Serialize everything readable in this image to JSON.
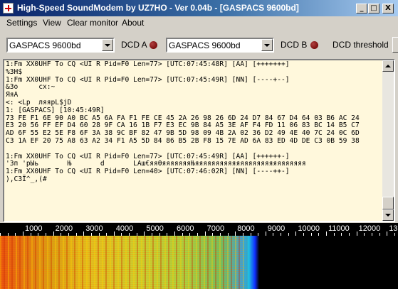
{
  "window": {
    "title": "High-Speed SoundModem by UZ7HO - Ver 0.04b - [GASPACS 9600bd]",
    "buttons": {
      "minimize": "_",
      "maximize": "□",
      "close": "X"
    }
  },
  "menu": {
    "settings": "Settings",
    "view": "View",
    "clear_monitor": "Clear monitor",
    "about": "About"
  },
  "toolbar": {
    "modem_a_value": "GASPACS 9600bd",
    "dcd_a_label": "DCD A",
    "modem_b_value": "GASPACS 9600bd",
    "dcd_b_label": "DCD B",
    "dcd_threshold_label": "DCD threshold"
  },
  "monitor": {
    "lines": [
      "1:Fm XX0UHF To CQ <UI R Pid=F0 Len=77> [UTC:07:45:48R] [AA] [+++++++]",
      "%3Н$",
      "1:Fm XX0UHF To CQ <UI R Pid=F0 Len=77> [UTC:07:45:49R] [NN] [----+--]",
      "&3о     cх:~",
      "ЯяА",
      "<: <Lp  ляярL$jD",
      "1: [GASPACS] [10:45:49R]",
      "73 FE F1 6E 90 A0 BC A5 6A FA F1 FE CE 45 2A 26 98 26 6D 24 D7 84 67 D4 64 03 B6 AC 24",
      "E3 20 56 FF EF D4 60 28 9F CA 16 1B F7 E3 EC 9B 84 A5 3E AF F4 FD 11 06 83 BC 14 B5 C7",
      "AD 6F 55 E2 5E F8 6F 3A 38 9C BF 82 47 9B 5D 98 09 4B 2A 02 36 D2 49 4E 40 7C 24 0C 6D",
      "C3 1A EF 20 75 A8 63 A2 34 F1 A5 5D 84 86 B5 2B F8 15 7E AD 6A 83 ED 4D DE C3 0B 59 38",
      "",
      "1:Fm XX0UHF To CQ <UI R Pid=F0 Len=77> [UTC:07:45:49R] [AA] [++++++-]",
      "'Зп 'рЫь       Њ       d       LАш€яяӨяяяяяяяЊяяяяяяяяяяяяяяяяяяяяяяяяяяя",
      "1:Fm XX0UHF To CQ <UI R Pid=F0 Len=40> [UTC:07:46:02R] [NN] [----++-]",
      "),С3Ї^_,(#"
    ]
  },
  "ruler": {
    "labels": [
      "1000",
      "2000",
      "3000",
      "4000",
      "5000",
      "6000",
      "7000",
      "8000",
      "9000",
      "10000",
      "11000",
      "12000",
      "13"
    ]
  }
}
